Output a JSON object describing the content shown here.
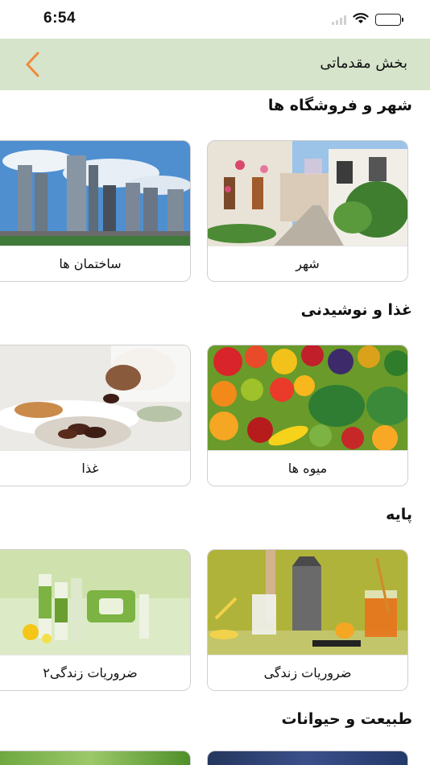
{
  "status_bar": {
    "time": "6:54"
  },
  "header": {
    "title": "بخش مقدماتی",
    "back_icon": "chevron-left-icon",
    "accent": "#f08a3c",
    "background": "#d6e4cb"
  },
  "sections": [
    {
      "title": "شهر و فروشگاه ها",
      "cards": [
        {
          "label": "شهر"
        },
        {
          "label": "ساختمان ها"
        }
      ]
    },
    {
      "title": "غذا و نوشیدنی",
      "cards": [
        {
          "label": "میوه ها"
        },
        {
          "label": "غذا"
        }
      ]
    },
    {
      "title": "پایه",
      "cards": [
        {
          "label": "ضروریات زندگی"
        },
        {
          "label": "ضروریات زندگی۲"
        }
      ]
    },
    {
      "title": "طبیعت و حیوانات",
      "cards": []
    }
  ]
}
